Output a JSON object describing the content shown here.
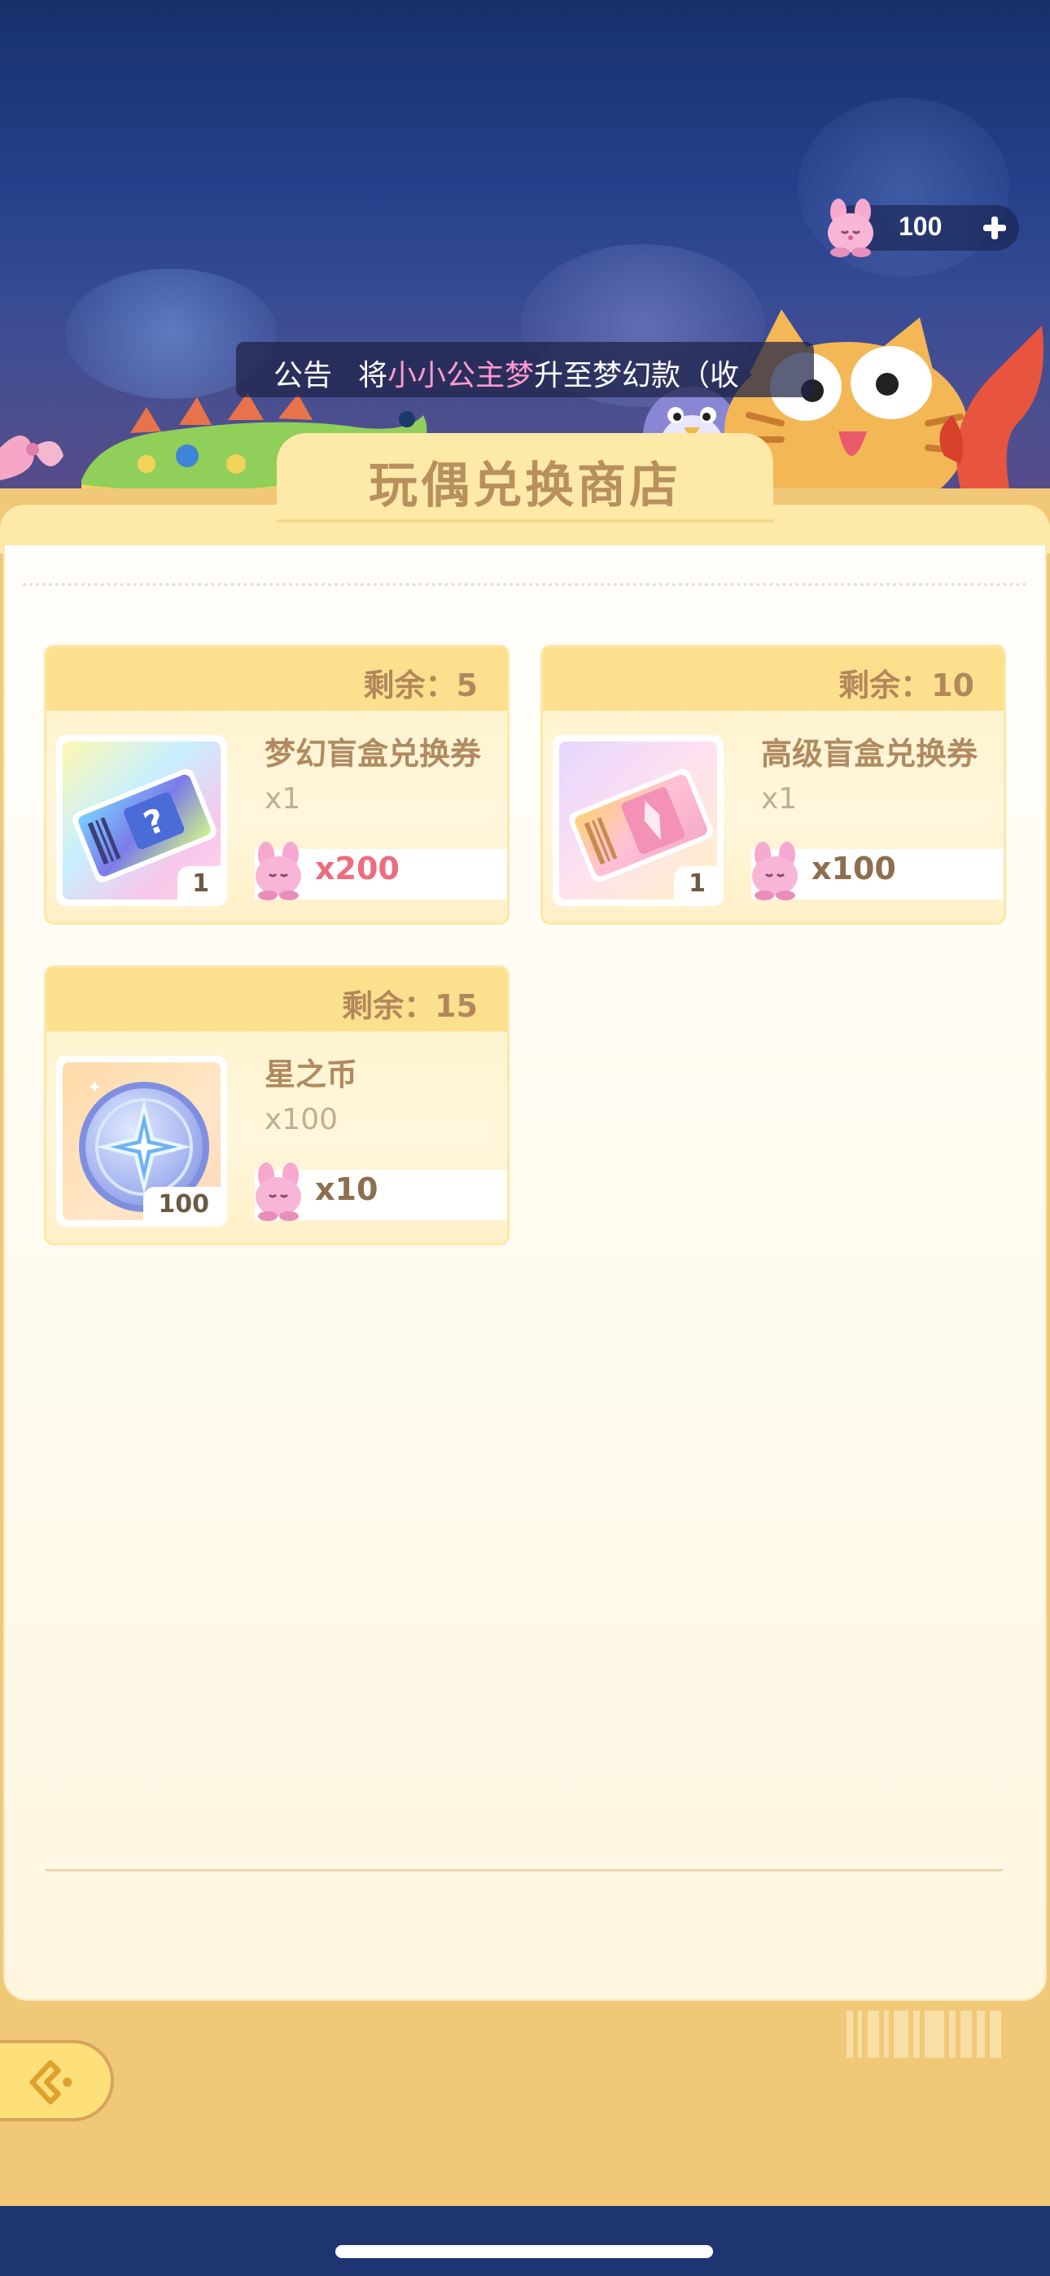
{
  "currency": {
    "amount": "100",
    "icon": "bunny-token-icon",
    "add_icon": "plus-icon"
  },
  "notice": {
    "tag": "公告",
    "prefix": "将",
    "highlight": "小小公主梦",
    "suffix": "升至梦幻款（收",
    "highlight_color": "#ff9ad0"
  },
  "shop": {
    "title": "玩偶兑换商店"
  },
  "items": [
    {
      "remain": "剩余：5",
      "name": "梦幻盲盒兑换券",
      "qty": "x1",
      "thumb_count": "1",
      "price": "x200",
      "price_color": "#ec6d7e",
      "icon": "dream-blindbox-ticket-icon"
    },
    {
      "remain": "剩余：10",
      "name": "高级盲盒兑换券",
      "qty": "x1",
      "thumb_count": "1",
      "price": "x100",
      "price_color": "#8d6e4e",
      "icon": "premium-blindbox-ticket-icon"
    },
    {
      "remain": "剩余：15",
      "name": "星之币",
      "qty": "x100",
      "thumb_count": "100",
      "price": "x10",
      "price_color": "#8d6e4e",
      "icon": "star-coin-icon"
    }
  ],
  "footer": {
    "back_icon": "back-arrow-icon"
  }
}
